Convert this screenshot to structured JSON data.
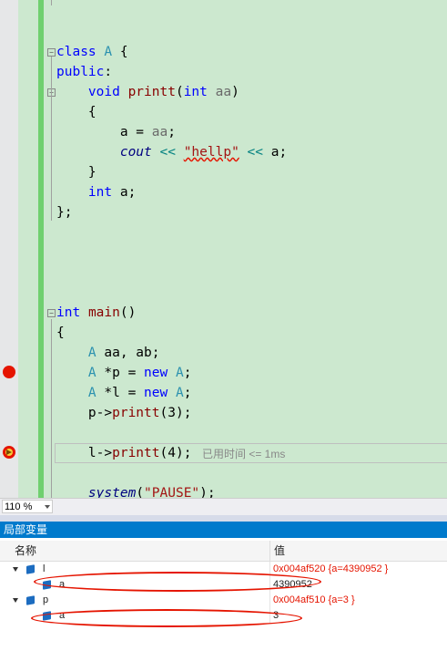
{
  "editor": {
    "lines": [
      {
        "id": "l1",
        "text": "class A {"
      },
      {
        "id": "l2",
        "text": "public:"
      },
      {
        "id": "l3",
        "text": "void printt(int aa)"
      },
      {
        "id": "l4",
        "text": "{"
      },
      {
        "id": "l5",
        "text": "a = aa;"
      },
      {
        "id": "l6",
        "text": "cout << \"hellp\" << a;"
      },
      {
        "id": "l7",
        "text": "}"
      },
      {
        "id": "l8",
        "text": "int a;"
      },
      {
        "id": "l9",
        "text": "};"
      },
      {
        "id": "l10",
        "text": "int main()"
      },
      {
        "id": "l11",
        "text": "{"
      },
      {
        "id": "l12",
        "text": "A aa, ab;"
      },
      {
        "id": "l13",
        "text": "A *p = new A;"
      },
      {
        "id": "l14",
        "text": "A *l = new A;"
      },
      {
        "id": "l15",
        "text": "p->printt(3);"
      },
      {
        "id": "l16",
        "text": "l->printt(4);"
      },
      {
        "id": "l17",
        "text": "system(\"PAUSE\");"
      }
    ],
    "elapsed": "已用时间 <= 1ms"
  },
  "zoom": {
    "value": "110 %"
  },
  "locals": {
    "title": "局部变量",
    "col_name": "名称",
    "col_value": "值",
    "rows": [
      {
        "name": "l",
        "value": "0x004af520 {a=4390952 }",
        "changed": true
      },
      {
        "name": "a",
        "value": "4390952",
        "changed": false
      },
      {
        "name": "p",
        "value": "0x004af510 {a=3 }",
        "changed": true
      },
      {
        "name": "a",
        "value": "3",
        "changed": false
      }
    ]
  },
  "colors": {
    "breakpoint": "#e51400",
    "accent": "#007acc",
    "editor_bg": "#cce8cf"
  }
}
